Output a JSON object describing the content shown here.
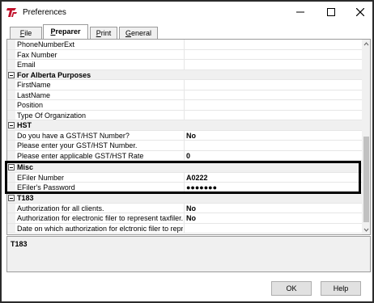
{
  "window": {
    "title": "Preferences"
  },
  "tabs": [
    {
      "underline": "F",
      "rest": "ile"
    },
    {
      "underline": "P",
      "rest": "reparer"
    },
    {
      "underline": "P",
      "rest": "rint"
    },
    {
      "underline": "G",
      "rest": "eneral"
    }
  ],
  "active_tab": "Preparer",
  "rows": [
    {
      "label": "PhoneNumberExt",
      "value": ""
    },
    {
      "label": "Fax Number",
      "value": ""
    },
    {
      "label": "Email",
      "value": ""
    },
    {
      "label": "For Alberta Purposes"
    },
    {
      "label": "FirstName",
      "value": ""
    },
    {
      "label": "LastName",
      "value": ""
    },
    {
      "label": "Position",
      "value": ""
    },
    {
      "label": "Type Of Organization",
      "value": ""
    },
    {
      "label": "HST"
    },
    {
      "label": "Do you have a GST/HST Number?",
      "value": "No"
    },
    {
      "label": "Please enter your GST/HST Number.",
      "value": ""
    },
    {
      "label": "Please enter applicable GST/HST Rate",
      "value": "0"
    },
    {
      "label": "Misc"
    },
    {
      "label": "EFiler Number",
      "value": "A0222"
    },
    {
      "label": "EFiler's Password",
      "value": "●●●●●●●"
    },
    {
      "label": "T183"
    },
    {
      "label": "Authorization for all clients.",
      "value": "No"
    },
    {
      "label": "Authorization for electronic filer to represent taxfiler.",
      "value": "No"
    },
    {
      "label": "Date on which authorization for elctronic filer to repr",
      "value": ""
    }
  ],
  "description": {
    "title": "T183"
  },
  "buttons": {
    "ok": "OK",
    "help": "Help"
  },
  "colors": {
    "app_icon": "#c0102a",
    "highlight": "#000000"
  },
  "icons": {
    "app": "app-logo-icon",
    "minimize": "minimize-icon",
    "maximize": "maximize-icon",
    "close": "close-icon",
    "collapse": "collapse-icon",
    "scroll_up": "chevron-up-icon",
    "scroll_down": "chevron-down-icon"
  }
}
